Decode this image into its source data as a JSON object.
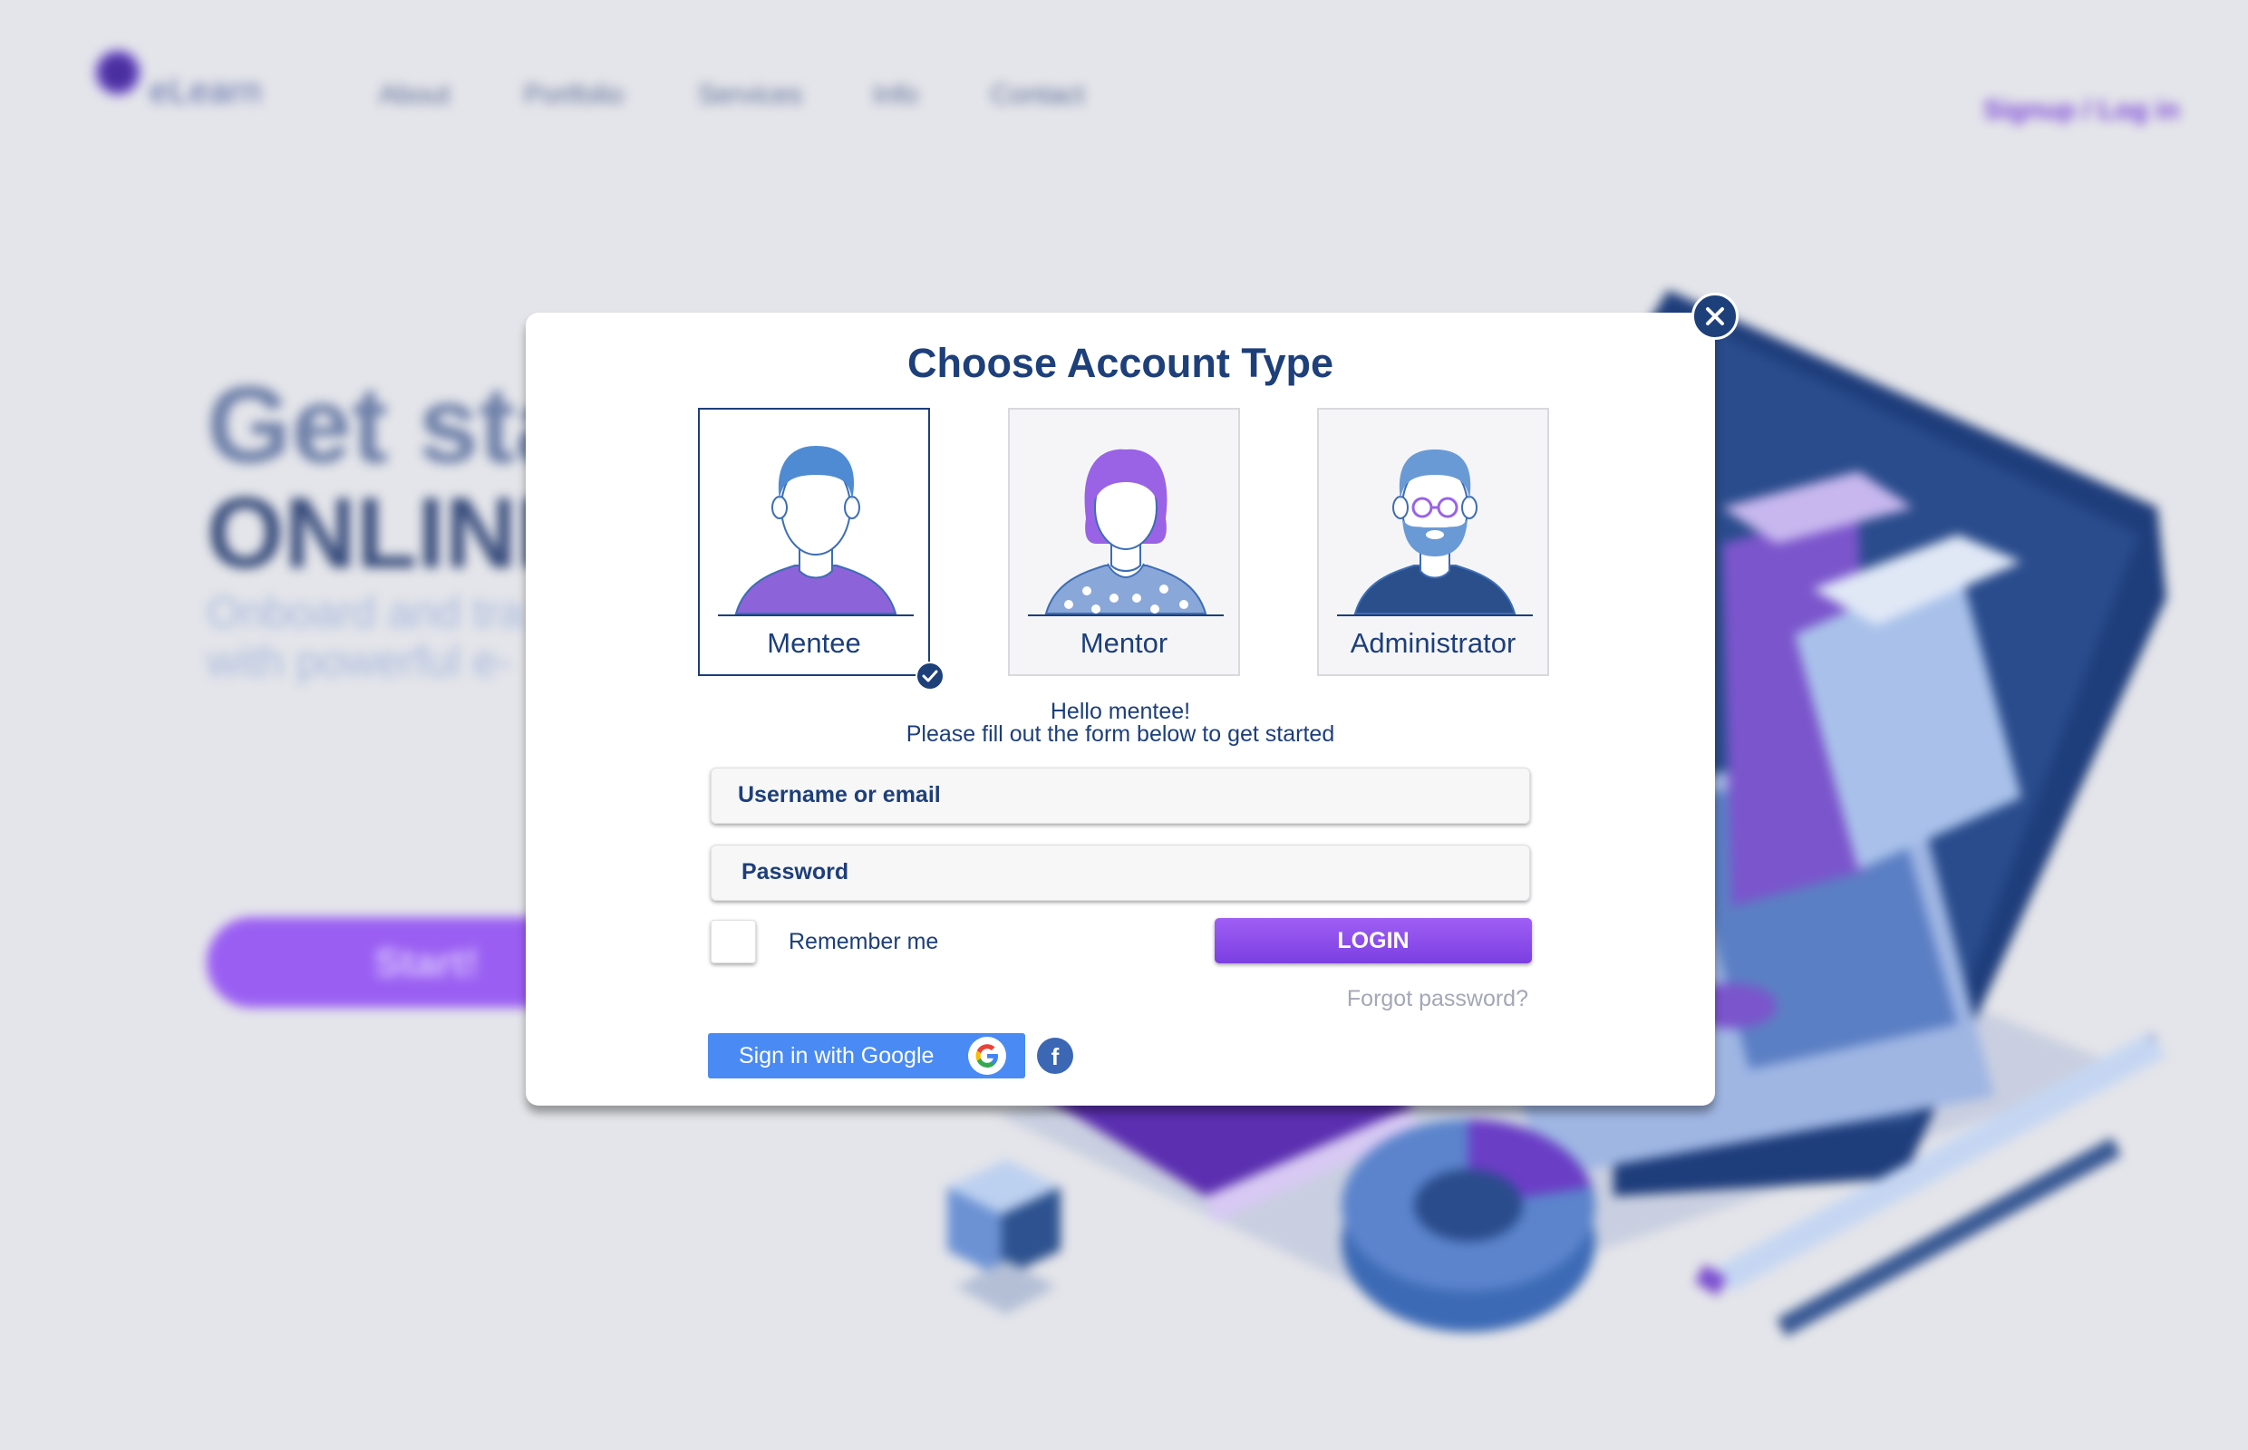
{
  "background": {
    "logo_text": "eLearn",
    "nav": [
      "About",
      "Portfolio",
      "Services",
      "Info",
      "Contact"
    ],
    "signup": "Signup / Log in",
    "hero_line1": "Get sta",
    "hero_line2": "ONLINE",
    "hero_line3": "Onboard and tra",
    "hero_line4": "with powerful e-",
    "start_button": "Start!"
  },
  "modal": {
    "title": "Choose Account Type",
    "account_types": [
      {
        "label": "Mentee",
        "selected": true
      },
      {
        "label": "Mentor",
        "selected": false
      },
      {
        "label": "Administrator",
        "selected": false
      }
    ],
    "greeting_line1": "Hello mentee!",
    "greeting_line2": "Please fill out the form below to get started",
    "username_placeholder": "Username or email",
    "password_placeholder": "Password",
    "remember_label": "Remember me",
    "remember_checked": false,
    "login_label": "LOGIN",
    "forgot_label": "Forgot password?",
    "google_label": "Sign in with Google",
    "facebook_icon": "facebook-icon"
  },
  "colors": {
    "primary": "#1d3f7a",
    "accent_purple": "#8b4ef0",
    "google_blue": "#4a8af4",
    "facebook_blue": "#3b67b4"
  }
}
